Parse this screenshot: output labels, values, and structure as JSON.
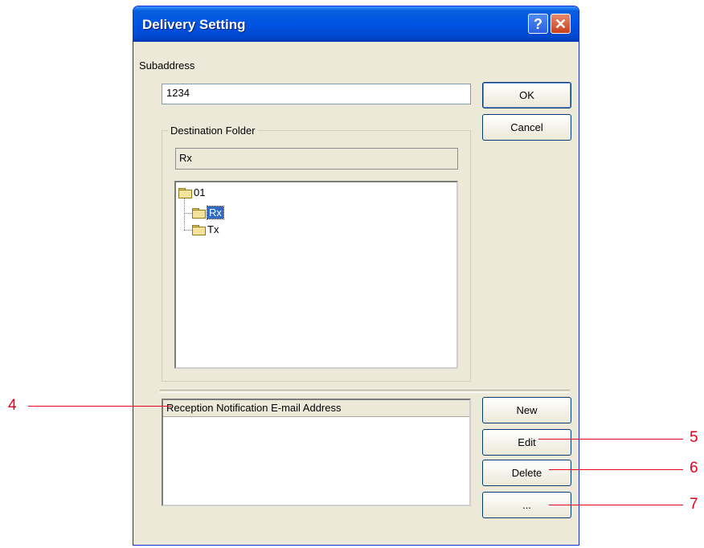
{
  "window": {
    "title": "Delivery Setting",
    "help_label": "?",
    "close_label": "✕"
  },
  "subaddress": {
    "label": "Subaddress",
    "value": "1234"
  },
  "buttons": {
    "ok": "OK",
    "cancel": "Cancel",
    "new": "New",
    "edit": "Edit",
    "delete": "Delete",
    "more": "..."
  },
  "destination": {
    "legend": "Destination Folder",
    "selected_path": "Rx",
    "tree": [
      {
        "label": "01",
        "level": 0
      },
      {
        "label": "Rx",
        "level": 1,
        "selected": true
      },
      {
        "label": "Tx",
        "level": 1
      }
    ]
  },
  "notification": {
    "header": "Reception Notification E-mail Address",
    "rows": []
  },
  "callouts": [
    "4",
    "5",
    "6",
    "7"
  ],
  "colors": {
    "callout": "#e8001c",
    "titlebar": "#0054e3",
    "selection": "#316ac5"
  }
}
